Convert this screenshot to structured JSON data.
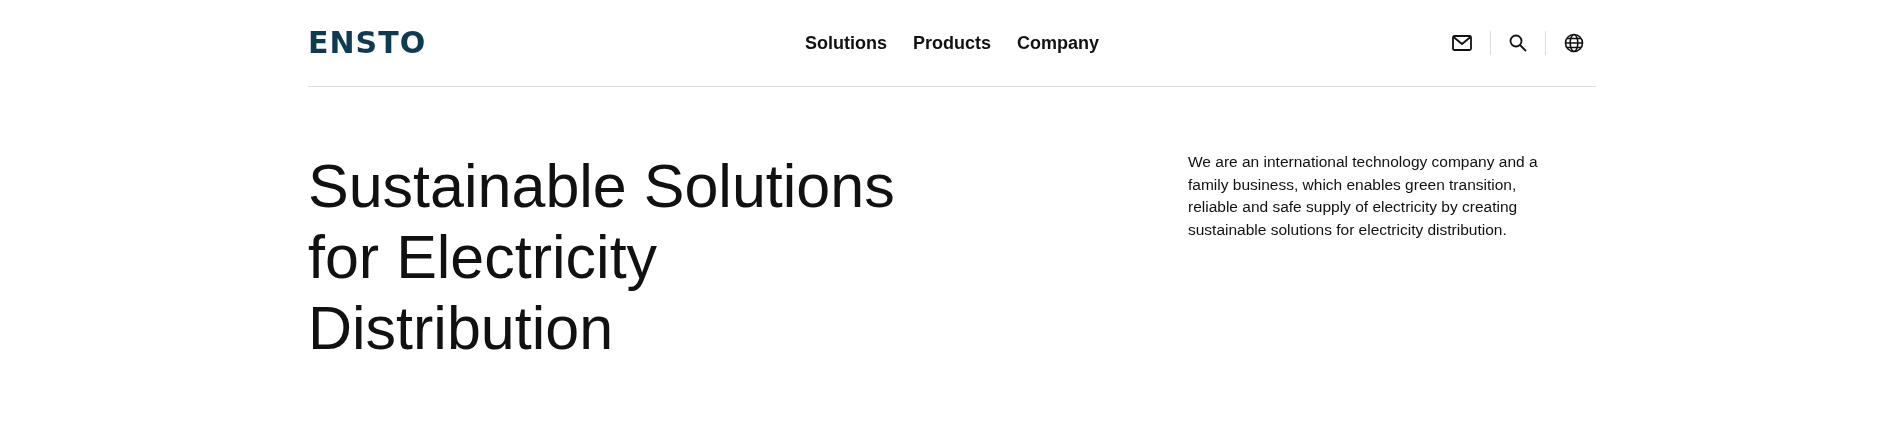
{
  "header": {
    "logo": "ENSTO",
    "nav": [
      {
        "label": "Solutions"
      },
      {
        "label": "Products"
      },
      {
        "label": "Company"
      }
    ],
    "icons": [
      {
        "kind": "mail"
      },
      {
        "kind": "search"
      },
      {
        "kind": "globe"
      }
    ]
  },
  "hero": {
    "heading_lines": [
      "Sustainable Solutions",
      "for Electricity",
      "Distribution"
    ],
    "intro_lines": [
      "We are an international technology company and a",
      "family business, which enables green transition,",
      "reliable and safe supply of electricity by creating",
      "sustainable solutions for electricity distribution."
    ]
  }
}
